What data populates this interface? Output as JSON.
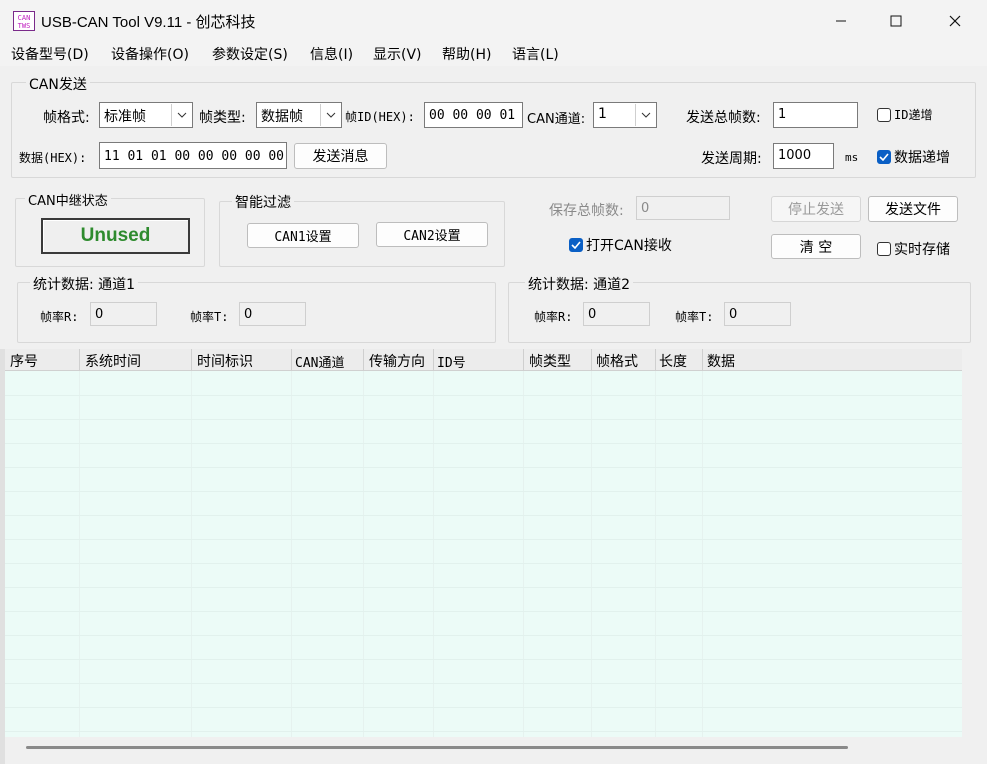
{
  "window": {
    "title": "USB-CAN Tool V9.11 - 创芯科技",
    "icon_text_top": "CAN",
    "icon_text_bottom": "TWS",
    "icons": [
      "app-icon",
      "minimize-icon",
      "maximize-icon",
      "close-icon"
    ]
  },
  "menu": [
    "设备型号(D)",
    "设备操作(O)",
    "参数设定(S)",
    "信息(I)",
    "显示(V)",
    "帮助(H)",
    "语言(L)"
  ],
  "can_send": {
    "group_label": "CAN发送",
    "frame_format_label": "帧格式:",
    "frame_format_value": "标准帧",
    "frame_type_label": "帧类型:",
    "frame_type_value": "数据帧",
    "frame_id_label": "帧ID(HEX):",
    "frame_id_value": "00 00 00 01",
    "can_channel_label": "CAN通道:",
    "can_channel_value": "1",
    "total_frames_label": "发送总帧数:",
    "total_frames_value": "1",
    "id_increment_label": "ID递增",
    "id_increment_checked": false,
    "data_label": "数据(HEX):",
    "data_value": "11 01 01 00 00 00 00 00",
    "send_button": "发送消息",
    "period_label": "发送周期:",
    "period_value": "1000",
    "period_unit": "ms",
    "data_increment_label": "数据递增",
    "data_increment_checked": true
  },
  "relay": {
    "group_label": "CAN中继状态",
    "status": "Unused",
    "status_color": "#2e8b2e"
  },
  "filter": {
    "group_label": "智能过滤",
    "can1_button": "CAN1设置",
    "can2_button": "CAN2设置"
  },
  "controls": {
    "save_total_label": "保存总帧数:",
    "save_total_value": "0",
    "stop_send_button": "停止发送",
    "send_file_button": "发送文件",
    "open_receive_label": "打开CAN接收",
    "open_receive_checked": true,
    "clear_button": "清 空",
    "realtime_save_label": "实时存储",
    "realtime_save_checked": false
  },
  "stats1": {
    "group_label": "统计数据: 通道1",
    "rate_r_label": "帧率R:",
    "rate_r_value": "0",
    "rate_t_label": "帧率T:",
    "rate_t_value": "0"
  },
  "stats2": {
    "group_label": "统计数据: 通道2",
    "rate_r_label": "帧率R:",
    "rate_r_value": "0",
    "rate_t_label": "帧率T:",
    "rate_t_value": "0"
  },
  "table": {
    "columns": [
      "序号",
      "系统时间",
      "时间标识",
      "CAN通道",
      "传输方向",
      "ID号",
      "帧类型",
      "帧格式",
      "长度",
      "数据"
    ]
  },
  "colors": {
    "accent": "#0a5fc5",
    "grid_background": "#ecfbf7"
  }
}
